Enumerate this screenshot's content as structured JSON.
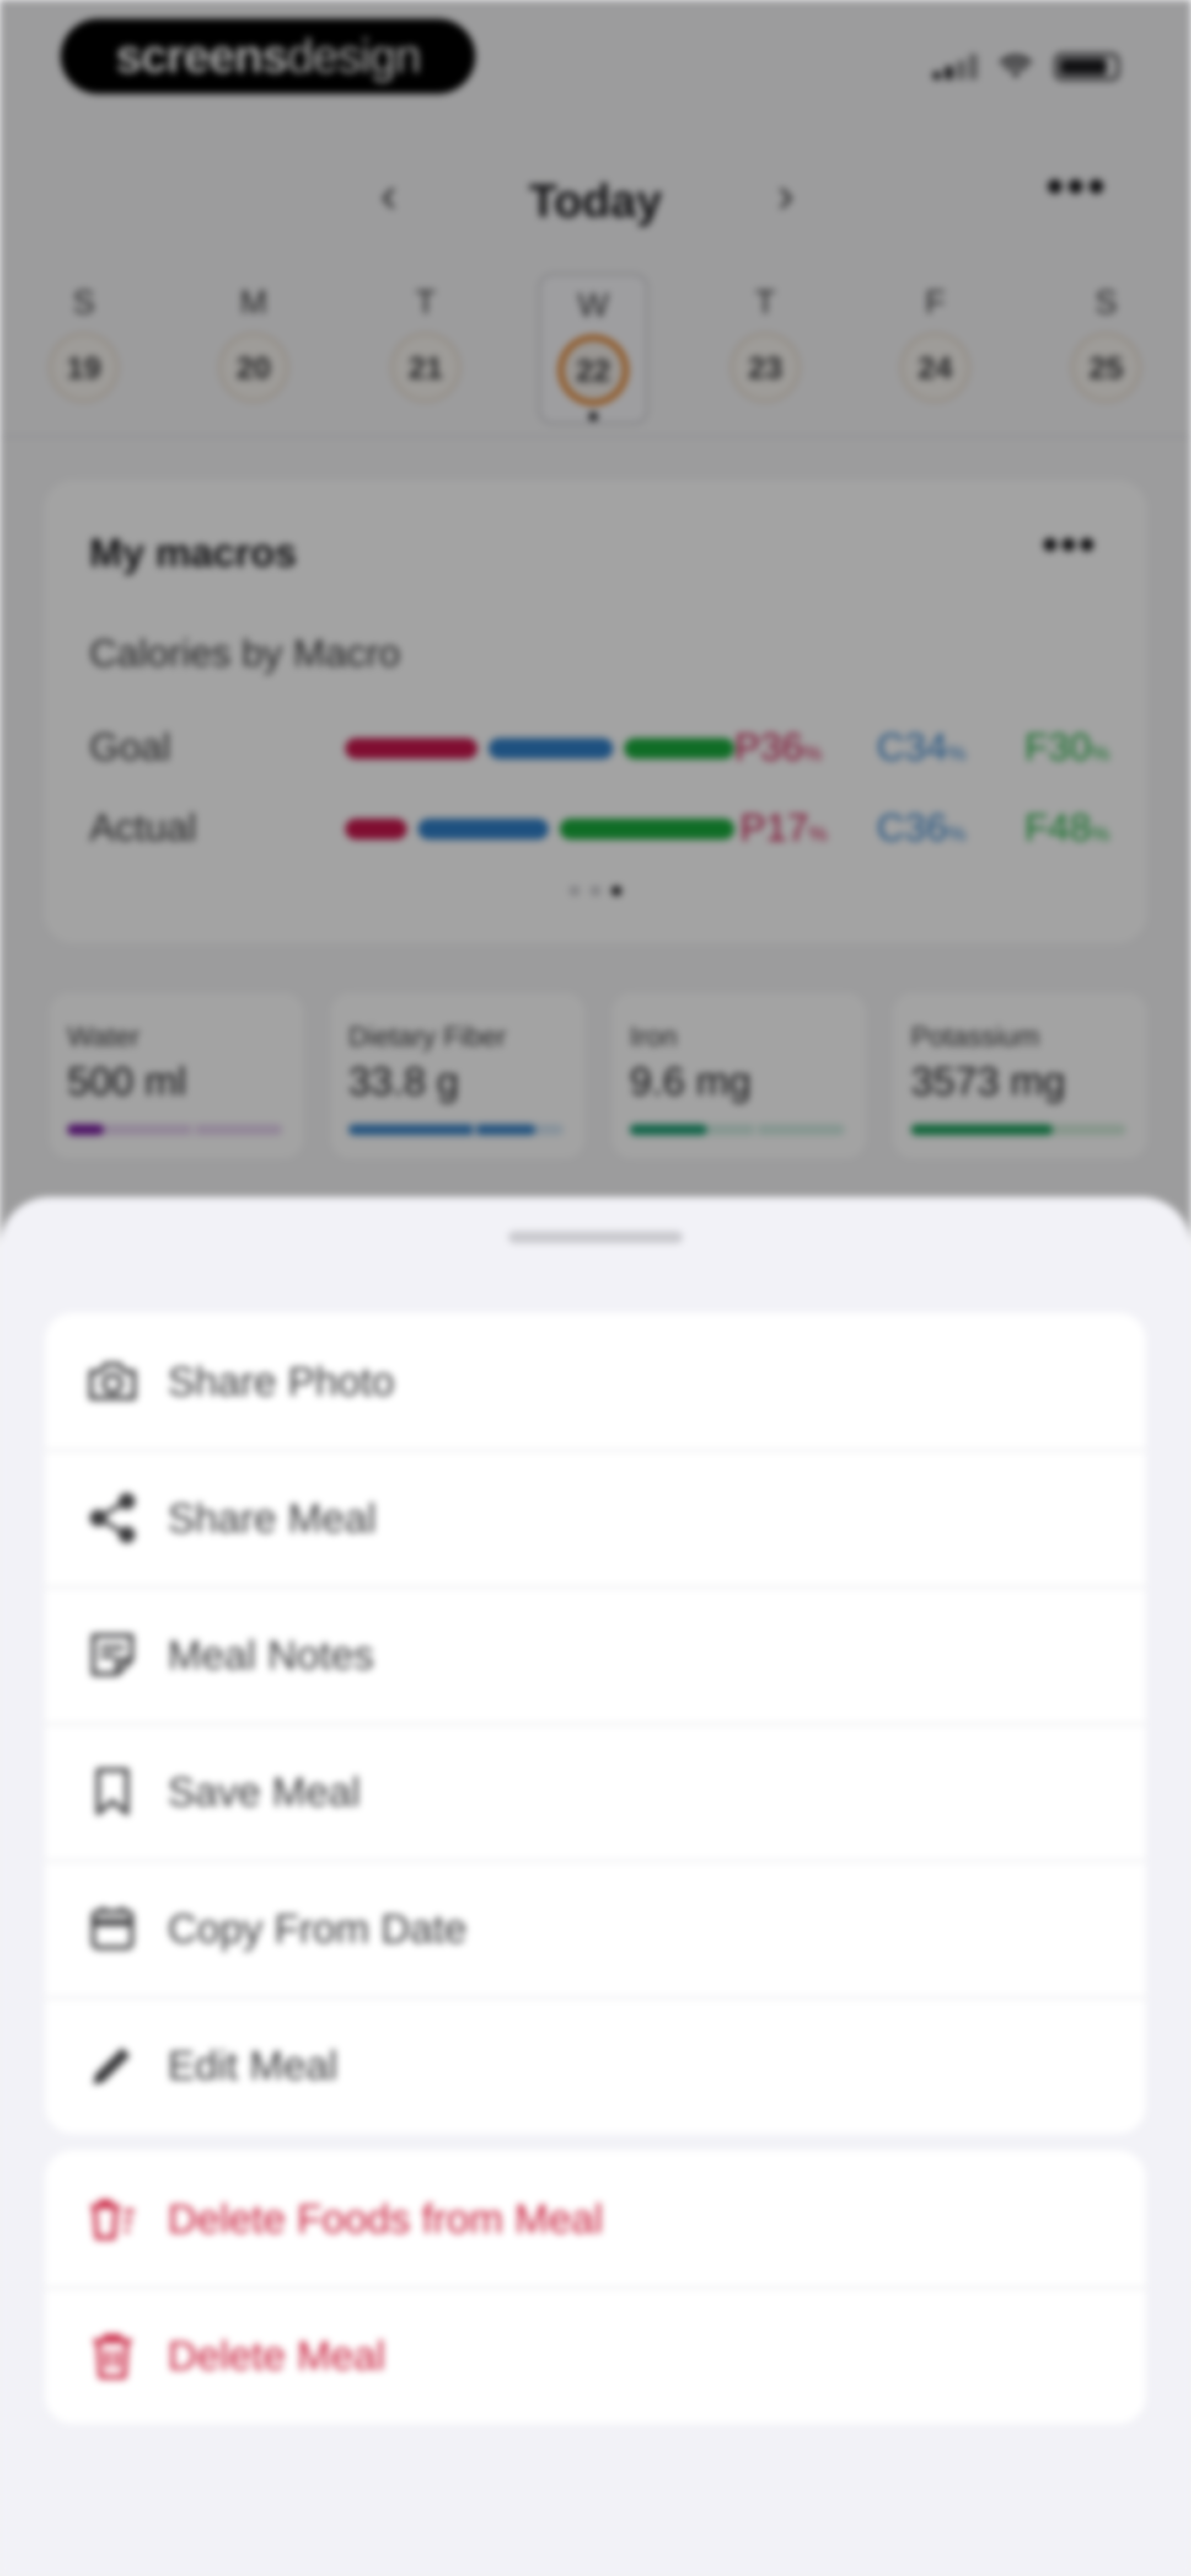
{
  "status_bar": {
    "brand_bold": "screens",
    "brand_light": "design"
  },
  "header": {
    "title": "Today",
    "prev_label": "‹",
    "next_label": "›",
    "more_label": "•••"
  },
  "week": {
    "days": [
      {
        "letter": "S",
        "num": "19"
      },
      {
        "letter": "M",
        "num": "20"
      },
      {
        "letter": "T",
        "num": "21"
      },
      {
        "letter": "W",
        "num": "22",
        "selected": true
      },
      {
        "letter": "T",
        "num": "23"
      },
      {
        "letter": "F",
        "num": "24"
      },
      {
        "letter": "S",
        "num": "25"
      }
    ]
  },
  "macros": {
    "title": "My macros",
    "more_label": "•••",
    "subtitle": "Calories by Macro",
    "goal": {
      "label": "Goal",
      "protein": "P36",
      "carbs": "C34",
      "fat": "F30",
      "unit": "%"
    },
    "actual": {
      "label": "Actual",
      "protein": "P17",
      "carbs": "C36",
      "fat": "F48",
      "unit": "%"
    },
    "colors": {
      "protein": "#c8174e",
      "carbs": "#2f7fc9",
      "fat": "#1aab3c"
    }
  },
  "nutrients": [
    {
      "name": "Water",
      "value": "500 ml",
      "progress": 0.17,
      "color": "#7b1fa2",
      "track": "#e7d3ef"
    },
    {
      "name": "Dietary Fiber",
      "value": "33.8 g",
      "progress": 0.87,
      "color": "#3b86c8",
      "track": "#d5e6f4"
    },
    {
      "name": "Iron",
      "value": "9.6 mg",
      "progress": 0.36,
      "color": "#1f9e74",
      "track": "#d2ede3"
    },
    {
      "name": "Potassium",
      "value": "3573 mg",
      "progress": 0.66,
      "color": "#1fa05e",
      "track": "#d3eddc"
    }
  ],
  "sheet": {
    "actions": [
      {
        "label": "Share Photo",
        "icon": "camera-icon"
      },
      {
        "label": "Share Meal",
        "icon": "share-icon"
      },
      {
        "label": "Meal Notes",
        "icon": "notes-icon"
      },
      {
        "label": "Save Meal",
        "icon": "bookmark-icon"
      },
      {
        "label": "Copy From Date",
        "icon": "calendar-icon"
      },
      {
        "label": "Edit Meal",
        "icon": "pencil-icon"
      }
    ],
    "destructive_actions": [
      {
        "label": "Delete Foods from Meal",
        "icon": "trash-multiple-icon"
      },
      {
        "label": "Delete Meal",
        "icon": "trash-icon"
      }
    ],
    "danger_color": "#c81e3c"
  }
}
